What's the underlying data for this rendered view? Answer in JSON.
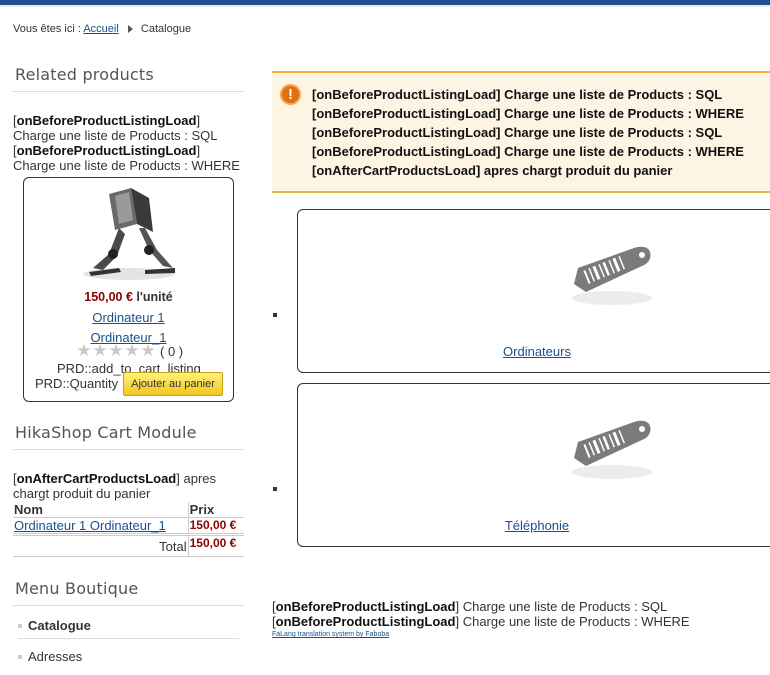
{
  "breadcrumb": {
    "prefix": "Vous êtes ici :",
    "home": "Accueil",
    "current": "Catalogue"
  },
  "related": {
    "title": "Related products",
    "debug": [
      {
        "event": "onBeforeProductListingLoad",
        "text": "Charge une liste de Products : SQL"
      },
      {
        "event": "onBeforeProductListingLoad",
        "text": "Charge une liste de Products : WHERE"
      }
    ],
    "product": {
      "price": "150,00 €",
      "unit": "l'unité",
      "name": "Ordinateur 1",
      "code": "Ordinateur_1",
      "rating_count": "( 0 )",
      "add_to_cart_tag": "PRD::add_to_cart_listing",
      "quantity_tag": "PRD::Quantity",
      "button": "Ajouter au panier"
    }
  },
  "cart": {
    "title": "HikaShop Cart Module",
    "debug": {
      "event": "onAfterCartProductsLoad",
      "text": "apres chargt produit du panier"
    },
    "col_name": "Nom",
    "col_price": "Prix",
    "item_name": "Ordinateur 1 Ordinateur_1",
    "item_price": "150,00 €",
    "total_label": "Total",
    "total_price": "150,00 €"
  },
  "menu": {
    "title": "Menu Boutique",
    "items": [
      "Catalogue",
      "Adresses"
    ]
  },
  "warning": {
    "lines": [
      "[onBeforeProductListingLoad] Charge une liste de Products : SQL",
      "[onBeforeProductListingLoad] Charge une liste de Products : WHERE",
      "[onBeforeProductListingLoad] Charge une liste de Products : SQL",
      "[onBeforeProductListingLoad] Charge une liste de Products : WHERE",
      "[onAfterCartProductsLoad] apres chargt produit du panier"
    ]
  },
  "categories": [
    "Ordinateurs",
    "Téléphonie"
  ],
  "bottom": {
    "debug": [
      {
        "event": "onBeforeProductListingLoad",
        "text": "Charge une liste de Products : SQL"
      },
      {
        "event": "onBeforeProductListingLoad",
        "text": "Charge une liste de Products : WHERE"
      }
    ],
    "falang": "FaLang translation system by Faboba"
  },
  "colors": {
    "link": "#1a4f8f",
    "price": "#8b0000",
    "topbar": "#1d4f8c",
    "warning_bg": "#fdf4e3"
  }
}
